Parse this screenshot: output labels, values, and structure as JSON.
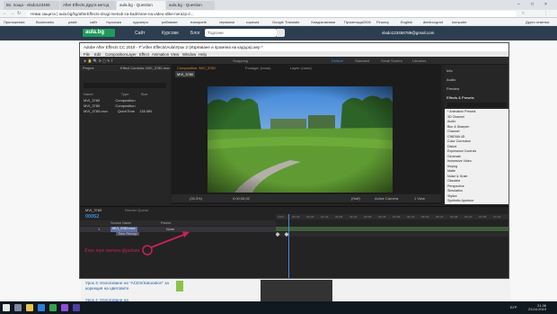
{
  "browser": {
    "tabs": [
      {
        "label": "Вх. поща - vlado123456",
        "active": false
      },
      {
        "label": "After Effects Друга метод",
        "active": false
      },
      {
        "label": "aula.bg - Question",
        "active": true
      },
      {
        "label": "aula.bg - Question",
        "active": false
      }
    ],
    "address": "Няма защита | aula.bg/bg/afterEffects-drugi-metodi-za-kadrirane-na-video-slike-nerazp-i/...",
    "address_secure_label": "Няма защита",
    "bookmarks": [
      "Приложения",
      "Bookmarks",
      "paste",
      "сайт",
      "търсачка",
      "курсиеро",
      "рибовове",
      "transporte",
      "сервизни",
      "горичиs",
      "Google Translate",
      "Хандикомпани",
      "Прометида2006",
      "Financy",
      "English",
      "dimitrovgrad",
      "komputer"
    ],
    "other_bookmarks": "Други отметки"
  },
  "site": {
    "logo": "aula.bg",
    "nav": [
      "Сайт",
      "Курсове",
      "Блог"
    ],
    "search_placeholder": "Търсене",
    "user": "vlado123456789@gmail.com"
  },
  "ae": {
    "title": "Adobe After Effects CC 2018 - F:\\After Effects\\Aula\\Урок 2 (Изрязване и промяна на кадъра).aep *",
    "menu": [
      "File",
      "Edit",
      "Composition",
      "Layer",
      "Effect",
      "Animation",
      "View",
      "Window",
      "Help"
    ],
    "workspaces": [
      "Default",
      "Standard",
      "Small Screen",
      "Libraries"
    ],
    "active_workspace": "Default",
    "snapping": "Snapping",
    "project_tab": "Project",
    "effect_controls_tab": "Effect Controls: MVI_3780.mov",
    "project_columns": [
      "Name",
      "Type",
      "Size"
    ],
    "project_items": [
      {
        "name": "MVI_3780",
        "type": "Composition",
        "size": ""
      },
      {
        "name": "MVI_3780",
        "type": "Composition",
        "size": ""
      },
      {
        "name": "MVI_3780.mov",
        "type": "QuickTime",
        "size": "135 MB"
      }
    ],
    "comp_tabs": [
      "Composition: MVI_3780",
      "Footage: (none)",
      "Layer: (none)"
    ],
    "comp_subtab": "MVI_3780",
    "viewer": {
      "zoom": "(33,3%)",
      "timecode": "0;00;06;02",
      "resolution": "(Half)",
      "camera": "Active Camera",
      "views": "1 View"
    },
    "side_panels": [
      "Info",
      "Audio",
      "Preview",
      "Effects & Presets"
    ],
    "effects": [
      "* Animation Presets",
      "3D Channel",
      "Audio",
      "Blur & Sharpen",
      "Channel",
      "CINEMA 4D",
      "Color Correction",
      "Distort",
      "Expression Controls",
      "Generate",
      "Immersive Video",
      "Keying",
      "Matte",
      "Noise & Grain",
      "Obsolete",
      "Perspective",
      "Simulation",
      "Stylize",
      "Synthetic Aperture"
    ],
    "timeline": {
      "tabs": [
        "MVI_3780",
        "Render Queue"
      ],
      "time": "00052",
      "columns": [
        "Source Name",
        "Parent"
      ],
      "layers": [
        {
          "num": "1",
          "name": "MVI_3780.mov",
          "parent": "None"
        },
        {
          "num": "",
          "name": "Time Remap",
          "parent": ""
        }
      ],
      "ruler": [
        "0:00f",
        "00:12f",
        "01:00f",
        "01:12f",
        "02:00f",
        "02:12f",
        "03:00f",
        "03:12f",
        "04:00f",
        "04:12f",
        "05:00f",
        "05:12f",
        "06:00f",
        "06:12f",
        "07:00f",
        "07:12f"
      ]
    }
  },
  "annotation": "Ето тук мачам фрейма",
  "lessons": [
    "Урок 3: Използване на \"ACES/Saturation\" за корекция на цветовете",
    "Урок 4: Използване на"
  ],
  "taskbar": {
    "time": "21:36",
    "date": "23.04.2019",
    "lang": "БГР"
  },
  "colors": {
    "ae_accent": "#3b8ee0",
    "annotation": "#c8205a",
    "site_header": "#2d3e50"
  }
}
